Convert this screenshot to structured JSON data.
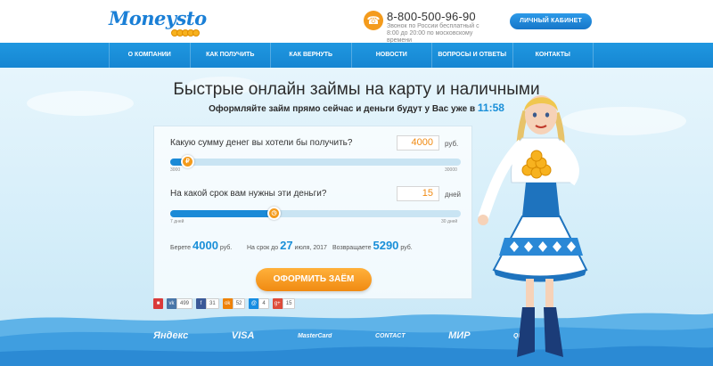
{
  "brand": {
    "logo_text": "Moneysto"
  },
  "header": {
    "phone": "8-800-500-96-90",
    "phone_note": "Звонок по России бесплатный с 8:00 до 20:00 по московскому времени",
    "cabinet_button": "ЛИЧНЫЙ КАБИНЕТ"
  },
  "nav": {
    "items": [
      "О КОМПАНИИ",
      "КАК ПОЛУЧИТЬ",
      "КАК ВЕРНУТЬ",
      "НОВОСТИ",
      "ВОПРОСЫ И ОТВЕТЫ",
      "КОНТАКТЫ"
    ]
  },
  "hero": {
    "title": "Быстрые онлайн займы на карту и наличными",
    "subtitle": "Оформляйте займ прямо сейчас и деньги будут у Вас уже в",
    "time": "11:58"
  },
  "calculator": {
    "amount": {
      "question": "Какую сумму денег вы хотели бы получить?",
      "value": "4000",
      "unit": "руб.",
      "min_label": "3000",
      "max_label": "30000",
      "level": 0.04
    },
    "term": {
      "question": "На какой срок вам нужны эти деньги?",
      "value": "15",
      "unit": "дней",
      "min_label": "7 дней",
      "max_label": "30 дней",
      "level": 0.35
    },
    "summary": {
      "take_label": "Берете",
      "take_value": "4000",
      "take_unit": "руб.",
      "until_label": "На срок до",
      "until_day": "27",
      "until_rest": "июля, 2017",
      "return_label": "Возвращаете",
      "return_value": "5290",
      "return_unit": "руб."
    },
    "apply_button": "ОФОРМИТЬ ЗАЁМ"
  },
  "share": [
    {
      "icon": "bookmark-icon",
      "glyph": "■",
      "color": "#d93a3a",
      "count": ""
    },
    {
      "icon": "vk-icon",
      "glyph": "vk",
      "color": "#4a76a8",
      "count": "499"
    },
    {
      "icon": "facebook-icon",
      "glyph": "f",
      "color": "#3b5998",
      "count": "31"
    },
    {
      "icon": "odnoklassniki-icon",
      "glyph": "ok",
      "color": "#ee8208",
      "count": "52"
    },
    {
      "icon": "moimir-icon",
      "glyph": "@",
      "color": "#168de2",
      "count": "4"
    },
    {
      "icon": "googleplus-icon",
      "glyph": "g+",
      "color": "#dd4b39",
      "count": "15"
    }
  ],
  "payment_logos": [
    "Яндекс",
    "VISA",
    "MasterCard",
    "CONTACT",
    "МИР",
    "QIWI"
  ],
  "colors": {
    "accent_blue": "#1a8fd8",
    "accent_orange": "#f08a12"
  }
}
